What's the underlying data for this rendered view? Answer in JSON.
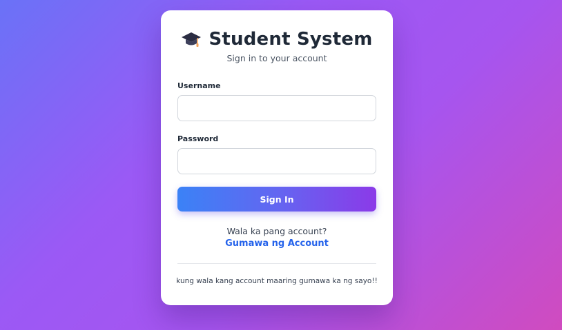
{
  "login": {
    "icon": "graduation-cap-icon",
    "title": "Student System",
    "subtitle": "Sign in to your account",
    "username_label": "Username",
    "username_value": "",
    "password_label": "Password",
    "password_value": "",
    "signin_label": "Sign In",
    "register_prompt": "Wala ka pang account?",
    "register_link": "Gumawa ng Account",
    "footer_note": "kung wala kang account maaring gumawa ka ng sayo!!"
  },
  "colors": {
    "accent_link": "#2563eb",
    "button_gradient_start": "#3b82f6",
    "button_gradient_end": "#8b3ae8",
    "title": "#1f2937"
  }
}
